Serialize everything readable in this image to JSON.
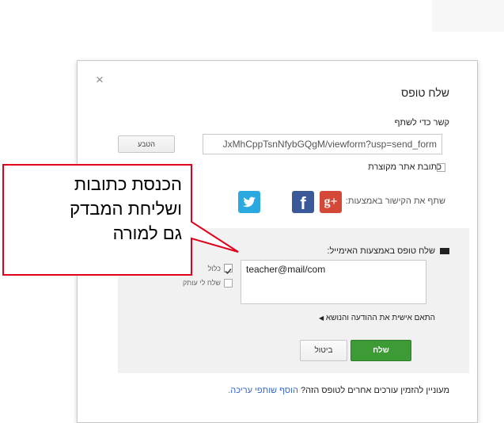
{
  "dialog": {
    "close_glyph": "×",
    "title": "שלח טופס",
    "share_link_label": "קשר כדי לשתף",
    "share_url": "JxMhCppTsnNfybGQgM/viewform?usp=send_form",
    "embed_button": "הטבע",
    "short_url_label": "כתובת אתר מקוצרת",
    "social_label": "שתף את הקישור באמצעות:",
    "social_icons": [
      "google-plus-icon",
      "facebook-icon",
      "twitter-icon"
    ],
    "email": {
      "heading": "שלח טופס באמצעות האימייל:",
      "to_value": "teacher@mail/com",
      "include_form_label": "כלול",
      "send_copy_label": "שלח לי עותק",
      "customize_label": "התאם אישית את ההודעה והנושא",
      "send_button": "שלח",
      "cancel_button": "ביטול"
    },
    "footer": {
      "text": "מעוניין להזמין עורכים אחרים לטופס הזה?",
      "link": "הוסף שותפי עריכה."
    }
  },
  "callout": {
    "lines": [
      "הכנסת כתובות",
      "ושליחת המבדק",
      "גם למורה"
    ],
    "border_color": "#e0001b"
  },
  "colors": {
    "send_green": "#3d9b35",
    "google_plus": "#d34836",
    "facebook": "#3b5998",
    "twitter": "#2aa9e0"
  }
}
